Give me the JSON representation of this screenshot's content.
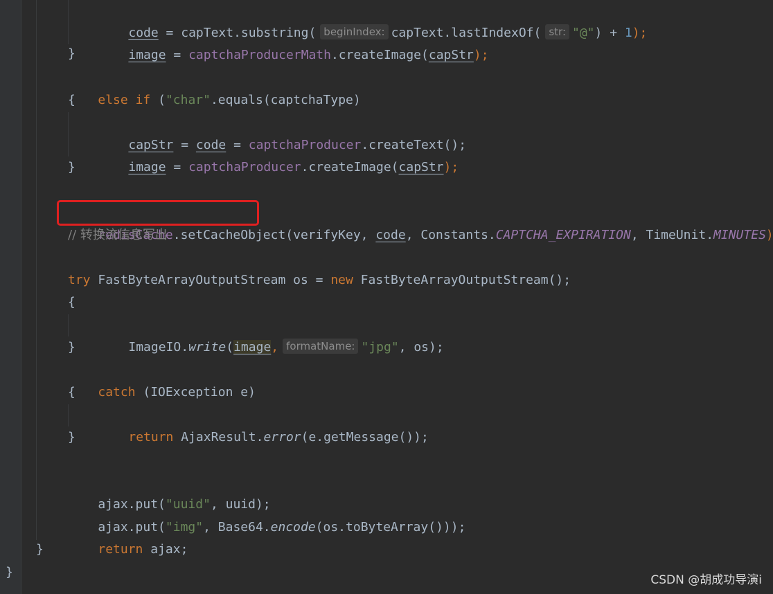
{
  "code": {
    "l1": {
      "a": "code",
      "b": " = capText.substring(",
      "hint": "beginIndex:",
      "c": "capText.lastIndexOf(",
      "hint2": "str:",
      "s": "\"@\"",
      "d": ") + ",
      "n": "1",
      "e": ");"
    },
    "l2": {
      "a": "image",
      "b": " = ",
      "f": "captchaProducerMath",
      "c": ".createImage(",
      "v": "capStr",
      "e": ");"
    },
    "l3": "}",
    "l4": {
      "kw1": "else",
      "sp": " ",
      "kw2": "if",
      "b": " (",
      "s": "\"char\"",
      "c": ".equals(captchaType)"
    },
    "l5": "{",
    "l6": {
      "a": "capStr",
      "b": " = ",
      "c": "code",
      "d": " = ",
      "f": "captchaProducer",
      "e": ".createText();"
    },
    "l7": {
      "a": "image",
      "b": " = ",
      "f": "captchaProducer",
      "c": ".createImage(",
      "v": "capStr",
      "e": ");"
    },
    "l8": "}",
    "l9": {
      "f": "redisCache",
      "a": ".setCacheObject",
      "b": "(verifyKey, ",
      "c": "code",
      "d": ", Constants.",
      "k": "CAPTCHA_EXPIRATION",
      "e": ", TimeUnit.",
      "m": "MINUTES",
      "z": ");"
    },
    "l10": "// 转换流信息写出",
    "l11": {
      "a": "FastByteArrayOutputStream os = ",
      "kw": "new",
      "b": " FastByteArrayOutputStream();"
    },
    "l12": "try",
    "l13": "{",
    "l14": {
      "a": "ImageIO.",
      "m": "write",
      "b": "(",
      "v": "image",
      "c": ",",
      "hint": "formatName:",
      "s": "\"jpg\"",
      "d": ", os);"
    },
    "l15": "}",
    "l16": {
      "kw": "catch",
      "b": " (IOException e)"
    },
    "l17": "{",
    "l18": {
      "kw": "return",
      "a": " AjaxResult.",
      "m": "error",
      "b": "(e.getMessage());"
    },
    "l19": "}",
    "l21": {
      "a": "ajax.put(",
      "s": "\"uuid\"",
      "b": ", uuid);"
    },
    "l22": {
      "a": "ajax.put(",
      "s": "\"img\"",
      "b": ", Base64.",
      "m": "encode",
      "c": "(os.toByteArray()));"
    },
    "l23": {
      "kw": "return",
      "a": " ajax;"
    },
    "l24": "}",
    "l25": "}"
  },
  "watermark": "CSDN @胡成功导演i"
}
